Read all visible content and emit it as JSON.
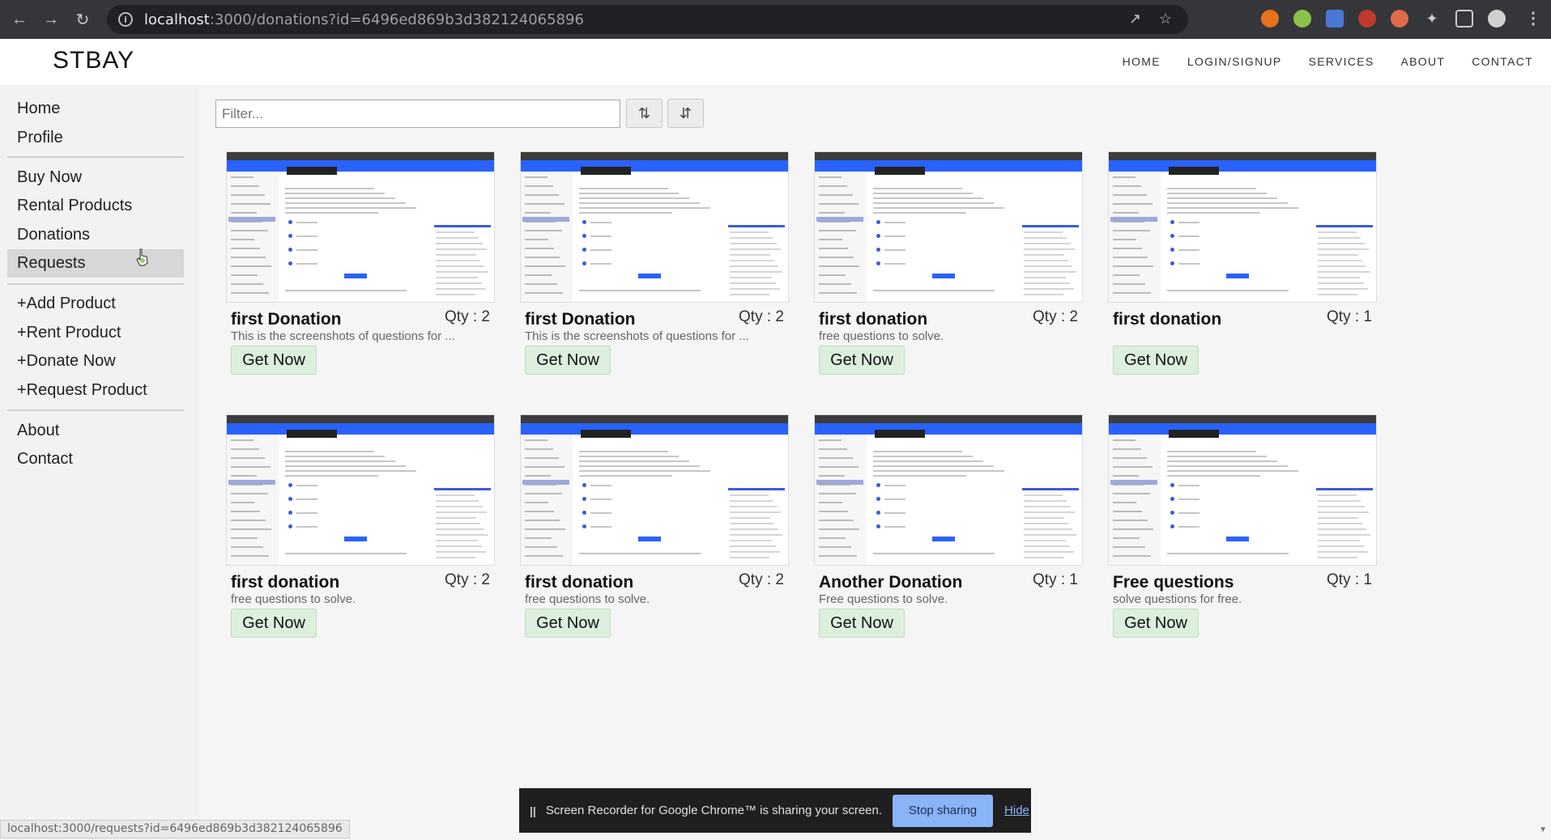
{
  "browser": {
    "url_host": "localhost",
    "url_rest": ":3000/donations?id=6496ed869b3d382124065896",
    "status_url": "localhost:3000/requests?id=6496ed869b3d382124065896"
  },
  "header": {
    "brand": "STBAY",
    "nav": [
      "HOME",
      "LOGIN/SIGNUP",
      "SERVICES",
      "ABOUT",
      "CONTACT"
    ]
  },
  "sidebar": {
    "items": [
      "Home",
      "Profile",
      "Buy Now",
      "Rental Products",
      "Donations",
      "Requests",
      "+Add Product",
      "+Rent Product",
      "+Donate Now",
      "+Request Product",
      "About",
      "Contact"
    ],
    "active": "Requests"
  },
  "filter": {
    "placeholder": "Filter..."
  },
  "cards": [
    {
      "title": "first Donation",
      "qty": "Qty : 2",
      "desc": "This is the screenshots of questions for ...",
      "button": "Get Now"
    },
    {
      "title": "first Donation",
      "qty": "Qty : 2",
      "desc": "This is the screenshots of questions for ...",
      "button": "Get Now"
    },
    {
      "title": "first donation",
      "qty": "Qty : 2",
      "desc": "free questions to solve.",
      "button": "Get Now"
    },
    {
      "title": "first donation",
      "qty": "Qty : 1",
      "desc": "",
      "button": "Get Now"
    },
    {
      "title": "first donation",
      "qty": "Qty : 2",
      "desc": "free questions to solve.",
      "button": "Get Now"
    },
    {
      "title": "first donation",
      "qty": "Qty : 2",
      "desc": "free questions to solve.",
      "button": "Get Now"
    },
    {
      "title": "Another Donation",
      "qty": "Qty : 1",
      "desc": "Free questions to solve.",
      "button": "Get Now"
    },
    {
      "title": "Free questions",
      "qty": "Qty : 1",
      "desc": "solve questions for free.",
      "button": "Get Now"
    }
  ],
  "sharebar": {
    "message": "Screen Recorder for Google Chrome™ is sharing your screen.",
    "stop": "Stop sharing",
    "hide": "Hide"
  }
}
